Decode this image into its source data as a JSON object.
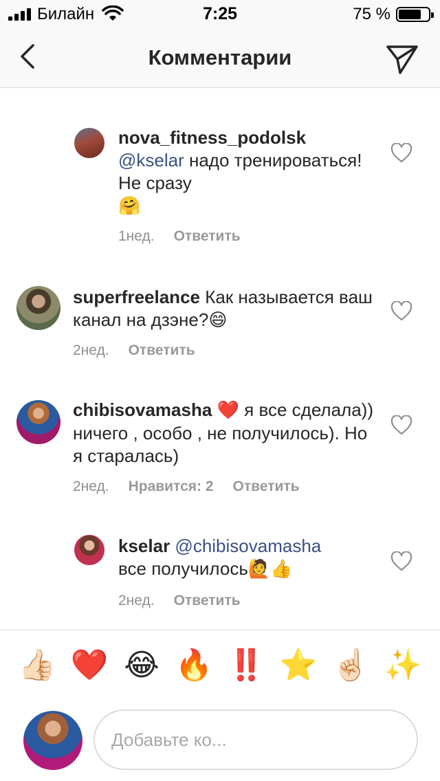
{
  "status_bar": {
    "carrier": "Билайн",
    "time": "7:25",
    "battery_percent": "75 %",
    "battery_level": 0.75
  },
  "nav": {
    "title": "Комментарии",
    "back_icon": "chevron-left-icon",
    "share_icon": "paper-plane-icon"
  },
  "comments": [
    {
      "username": "nova_fitness_podolsk",
      "mention": "@kselar",
      "text": " надо тренироваться! Не сразу ",
      "emoji": "🤗",
      "time": "1нед.",
      "likes": "",
      "reply": "Ответить",
      "is_reply": true
    },
    {
      "username": "superfreelance",
      "mention": "",
      "text": " Как называется ваш канал на дзэне?",
      "emoji": "😄",
      "time": "2нед.",
      "likes": "",
      "reply": "Ответить",
      "is_reply": false
    },
    {
      "username": "chibisovamasha",
      "mention": "",
      "emoji_first": "❤️",
      "text": " я все сделала)) ничего , особо , не получилось). Но я старалась)",
      "time": "2нед.",
      "likes": "Нравится: 2",
      "reply": "Ответить",
      "is_reply": false
    },
    {
      "username": "kselar",
      "mention": "@chibisovamasha",
      "text": " все получилось",
      "emoji": "🙋👍",
      "time": "2нед.",
      "likes": "",
      "reply": "Ответить",
      "is_reply": true
    }
  ],
  "emoji_bar": [
    "👍🏻",
    "❤️",
    "😂",
    "🔥",
    "‼️",
    "⭐",
    "☝🏻",
    "✨"
  ],
  "composer": {
    "placeholder": "Добавьте ко..."
  },
  "colors": {
    "mention": "#385185",
    "meta": "#8e8e8e",
    "divider": "#dbdbdb",
    "heart_red": "#ed4956"
  }
}
